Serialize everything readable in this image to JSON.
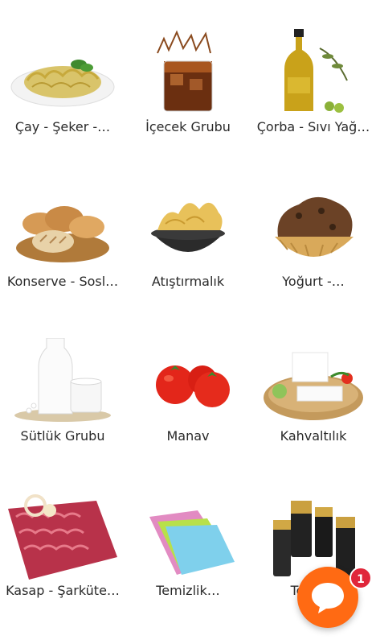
{
  "categories": [
    {
      "label": "Çay - Şeker -…"
    },
    {
      "label": "İçecek Grubu"
    },
    {
      "label": "Çorba - Sıvı Yağ…"
    },
    {
      "label": "Konserve - Sosl…"
    },
    {
      "label": "Atıştırmalık"
    },
    {
      "label": "Yoğurt -…"
    },
    {
      "label": "Sütlük Grubu"
    },
    {
      "label": "Manav"
    },
    {
      "label": "Kahvaltılık"
    },
    {
      "label": "Kasap - Şarküte…"
    },
    {
      "label": "Temizlik…"
    },
    {
      "label": "Tekst…"
    }
  ],
  "chat": {
    "icon": "chat-bubble-icon",
    "badge_count": "1",
    "accent_color": "#ff6a13",
    "badge_color": "#e0263a"
  }
}
